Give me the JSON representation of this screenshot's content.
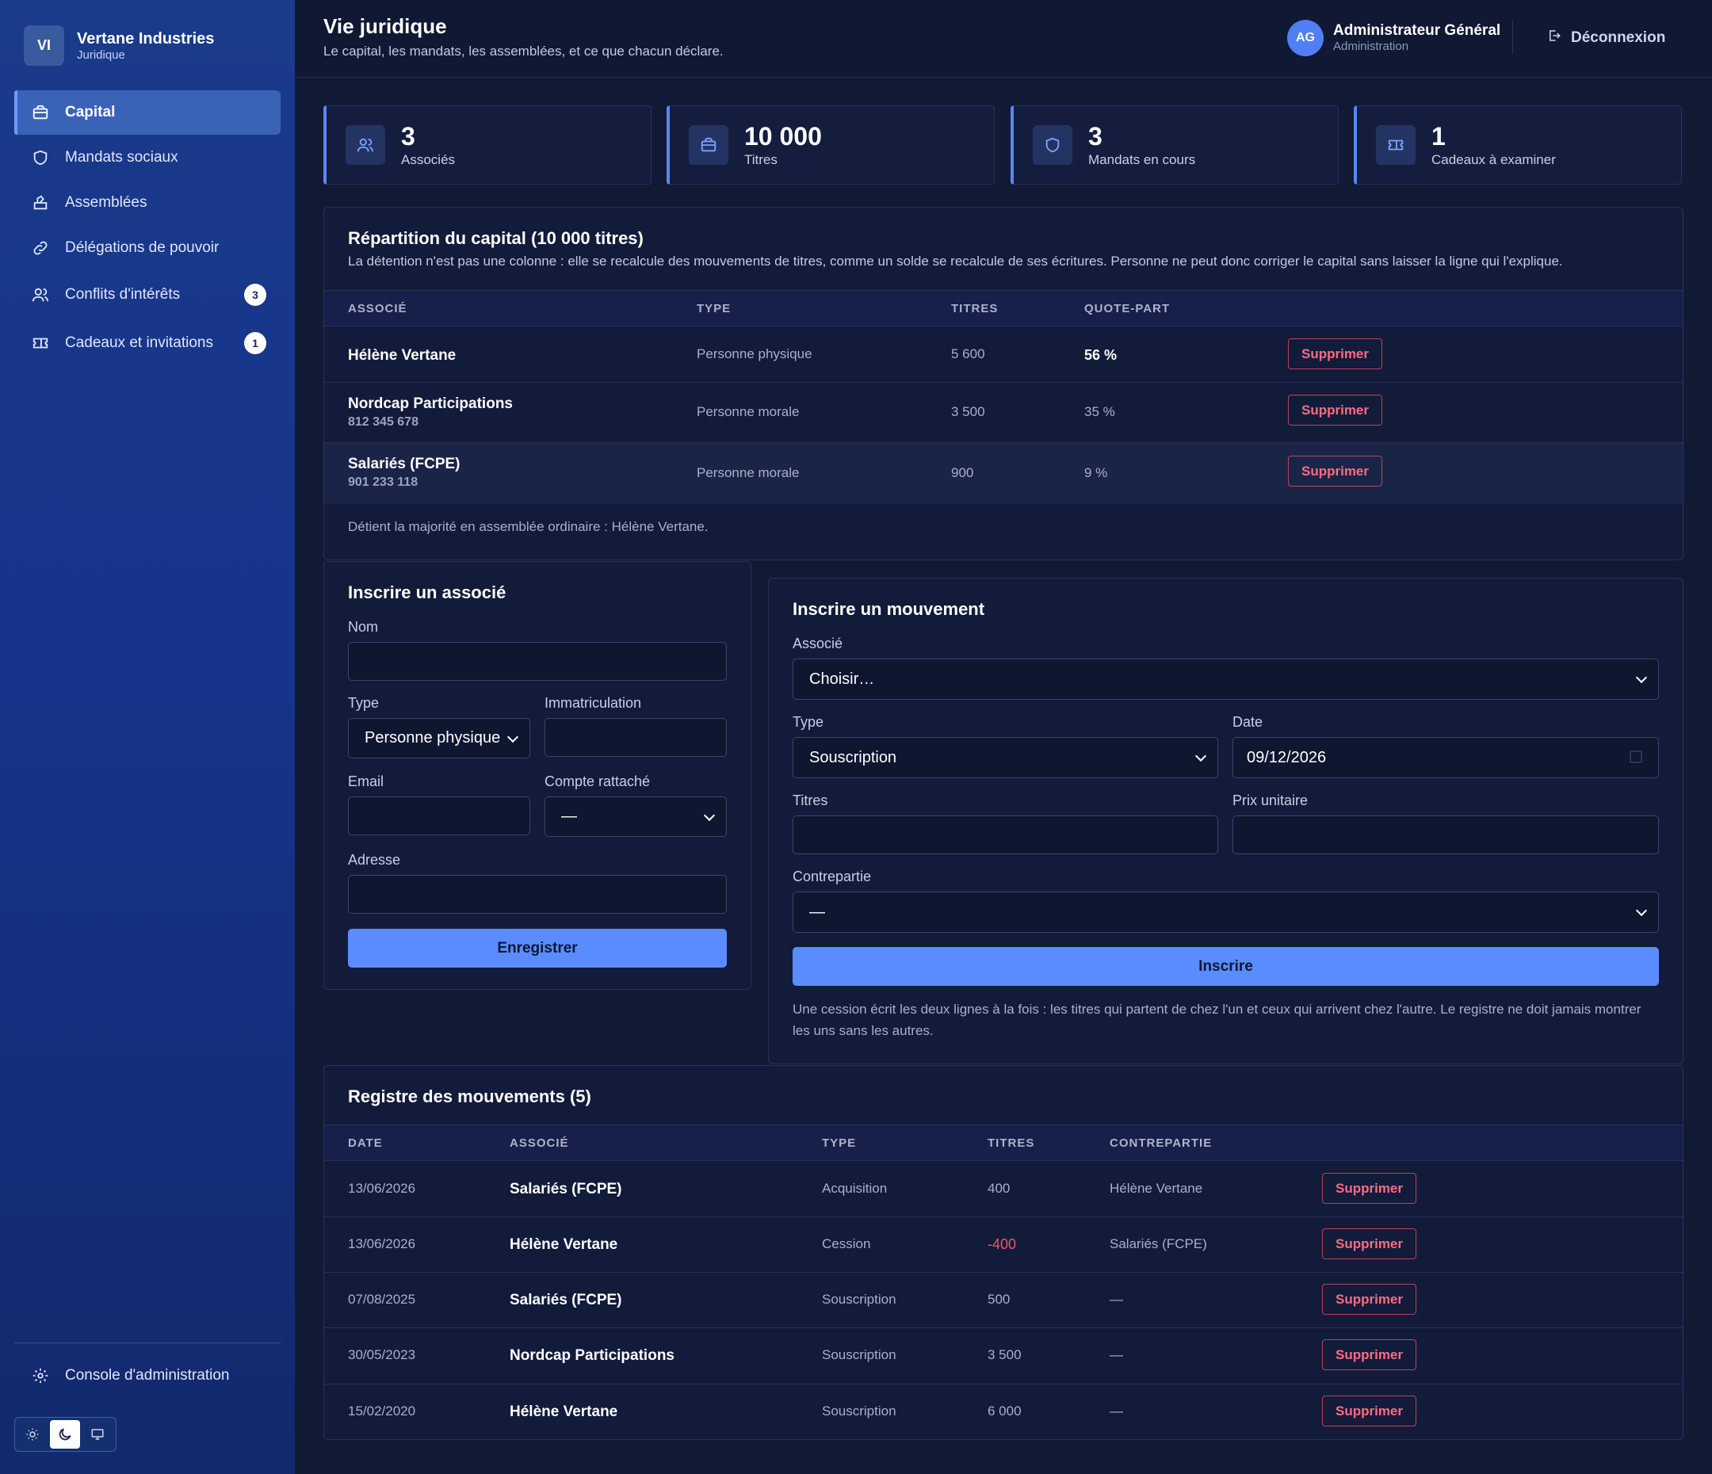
{
  "brand": {
    "initials": "VI",
    "name": "Vertane Industries",
    "subtitle": "Juridique"
  },
  "sidebar": {
    "items": [
      {
        "label": "Capital",
        "icon": "briefcase-icon",
        "active": true
      },
      {
        "label": "Mandats sociaux",
        "icon": "shield-icon"
      },
      {
        "label": "Assemblées",
        "icon": "ballot-box-icon"
      },
      {
        "label": "Délégations de pouvoir",
        "icon": "link-icon"
      },
      {
        "label": "Conflits d'intérêts",
        "icon": "users-icon",
        "badge": "3"
      },
      {
        "label": "Cadeaux et invitations",
        "icon": "ticket-icon",
        "badge": "1"
      }
    ],
    "console_label": "Console d'administration",
    "theme": {
      "options": [
        "sun-icon",
        "moon-icon",
        "monitor-icon"
      ],
      "selected": "moon-icon"
    }
  },
  "header": {
    "title": "Vie juridique",
    "subtitle": "Le capital, les mandats, les assemblées, et ce que chacun déclare.",
    "user": {
      "initials": "AG",
      "name": "Administrateur Général",
      "role": "Administration"
    },
    "logout_label": "Déconnexion"
  },
  "stats": [
    {
      "value": "3",
      "label": "Associés",
      "icon": "users-icon"
    },
    {
      "value": "10 000",
      "label": "Titres",
      "icon": "briefcase-icon"
    },
    {
      "value": "3",
      "label": "Mandats en cours",
      "icon": "shield-icon"
    },
    {
      "value": "1",
      "label": "Cadeaux à examiner",
      "icon": "ticket-icon"
    }
  ],
  "capital": {
    "title": "Répartition du capital (10 000 titres)",
    "description": "La détention n'est pas une colonne : elle se recalcule des mouvements de titres, comme un solde se recalcule de ses écritures. Personne ne peut donc corriger le capital sans laisser la ligne qui l'explique.",
    "columns": [
      "ASSOCIÉ",
      "TYPE",
      "TITRES",
      "QUOTE-PART"
    ],
    "rows": [
      {
        "name": "Hélène Vertane",
        "id": "",
        "type": "Personne physique",
        "titres": "5 600",
        "quote": "56 %",
        "action": "Supprimer"
      },
      {
        "name": "Nordcap Participations",
        "id": "812 345 678",
        "type": "Personne morale",
        "titres": "3 500",
        "quote": "35 %",
        "action": "Supprimer"
      },
      {
        "name": "Salariés (FCPE)",
        "id": "901 233 118",
        "type": "Personne morale",
        "titres": "900",
        "quote": "9 %",
        "action": "Supprimer"
      }
    ],
    "majority_note": "Détient la majorité en assemblée ordinaire : Hélène Vertane."
  },
  "associe_form": {
    "title": "Inscrire un associé",
    "nom_label": "Nom",
    "nom_value": "",
    "type_label": "Type",
    "type_value": "Personne physique",
    "immat_label": "Immatriculation",
    "immat_value": "",
    "email_label": "Email",
    "email_value": "",
    "compte_label": "Compte rattaché",
    "compte_value": "—",
    "adresse_label": "Adresse",
    "adresse_value": "",
    "submit_label": "Enregistrer"
  },
  "mouvement_form": {
    "title": "Inscrire un mouvement",
    "associe_label": "Associé",
    "associe_value": "Choisir…",
    "type_label": "Type",
    "type_value": "Souscription",
    "date_label": "Date",
    "date_value": "09/12/2026",
    "titres_label": "Titres",
    "titres_value": "",
    "prix_label": "Prix unitaire",
    "prix_value": "",
    "contrepartie_label": "Contrepartie",
    "contrepartie_value": "—",
    "submit_label": "Inscrire",
    "hint": "Une cession écrit les deux lignes à la fois : les titres qui partent de chez l'un et ceux qui arrivent chez l'autre. Le registre ne doit jamais montrer les uns sans les autres."
  },
  "registre": {
    "title": "Registre des mouvements (5)",
    "columns": [
      "DATE",
      "ASSOCIÉ",
      "TYPE",
      "TITRES",
      "CONTREPARTIE"
    ],
    "rows": [
      {
        "date": "13/06/2026",
        "associe": "Salariés (FCPE)",
        "type": "Acquisition",
        "titres": "400",
        "contrepartie": "Hélène Vertane",
        "action": "Supprimer"
      },
      {
        "date": "13/06/2026",
        "associe": "Hélène Vertane",
        "type": "Cession",
        "titres": "-400",
        "contrepartie": "Salariés (FCPE)",
        "action": "Supprimer"
      },
      {
        "date": "07/08/2025",
        "associe": "Salariés (FCPE)",
        "type": "Souscription",
        "titres": "500",
        "contrepartie": "—",
        "action": "Supprimer"
      },
      {
        "date": "30/05/2023",
        "associe": "Nordcap Participations",
        "type": "Souscription",
        "titres": "3 500",
        "contrepartie": "—",
        "action": "Supprimer"
      },
      {
        "date": "15/02/2020",
        "associe": "Hélène Vertane",
        "type": "Souscription",
        "titres": "6 000",
        "contrepartie": "—",
        "action": "Supprimer"
      }
    ]
  },
  "colors": {
    "accent": "#5b8cff",
    "danger": "#ff6b81",
    "sidebar": "#16348a",
    "background": "#111a35"
  }
}
